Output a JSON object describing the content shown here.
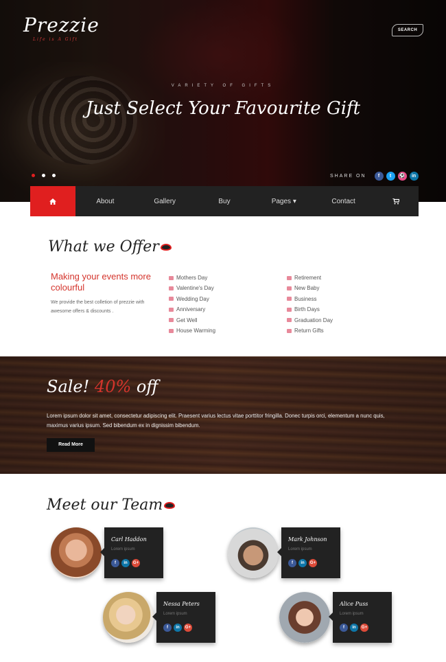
{
  "header": {
    "logo": "Prezzie",
    "tagline": "Life is A Gift",
    "search_label": "SEARCH"
  },
  "hero": {
    "kicker": "VARIETY OF GIFTS",
    "headline": "Just Select Your Favourite Gift",
    "slides": 3,
    "active_slide": 1,
    "share_label": "SHARE ON",
    "share_icons": [
      {
        "icon": "facebook-icon",
        "glyph": "f",
        "color": "#3b5998"
      },
      {
        "icon": "twitter-icon",
        "glyph": "t",
        "color": "#1da1f2"
      },
      {
        "icon": "dribbble-icon",
        "glyph": "⚽",
        "color": "#ea4c89"
      },
      {
        "icon": "linkedin-icon",
        "glyph": "in",
        "color": "#0e76a8"
      }
    ]
  },
  "nav": {
    "home_icon": "home-icon",
    "items": [
      "About",
      "Gallery",
      "Buy",
      "Pages ▾",
      "Contact"
    ],
    "cart_icon": "cart-icon",
    "active_color": "#e01f1f"
  },
  "offer": {
    "title": "What we Offer",
    "heading": "Making your events more colourful",
    "description": "We provide the best colletion of prezzie with awesome offers & discounts .",
    "list1": [
      "Mothers Day",
      "Valentine's Day",
      "Wedding Day",
      "Anniversary",
      "Get Well",
      "House Warming"
    ],
    "list2": [
      "Retirement",
      "New Baby",
      "Business",
      "Birth Days",
      "Graduation Day",
      "Return Gifts"
    ]
  },
  "sale": {
    "title_prefix": "Sale!",
    "title_percent": "40%",
    "title_suffix": "off",
    "text": "Lorem ipsum dolor sit amet, consectetur adipiscing elit. Praesent varius lectus vitae porttitor fringilla. Donec turpis orci, elementum a nunc quis, maximus varius ipsum. Sed bibendum ex in dignissim bibendum.",
    "button": "Read More"
  },
  "team": {
    "title": "Meet our Team",
    "members": [
      {
        "name": "Carl Haddon",
        "role": "Lorem ipsum"
      },
      {
        "name": "Mark Johnson",
        "role": "Lorem ipsum"
      },
      {
        "name": "Nessa Peters",
        "role": "Lorem ipsum"
      },
      {
        "name": "Alice Puss",
        "role": "Lorem ipsum"
      }
    ],
    "social": [
      {
        "icon": "facebook-icon",
        "glyph": "f",
        "color": "#3b5998"
      },
      {
        "icon": "linkedin-icon",
        "glyph": "in",
        "color": "#0e76a8"
      },
      {
        "icon": "google-plus-icon",
        "glyph": "G+",
        "color": "#dd4b39"
      }
    ]
  }
}
